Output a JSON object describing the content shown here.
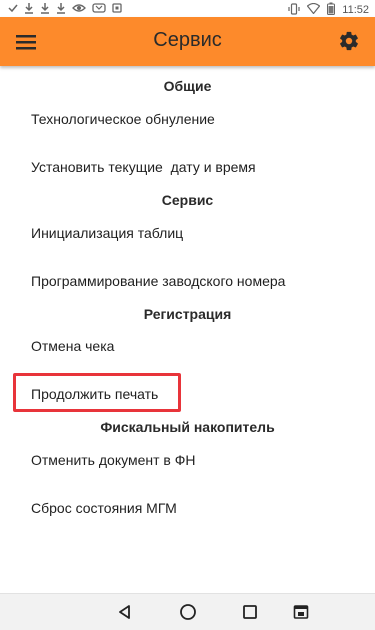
{
  "status_bar": {
    "time": "11:52",
    "left_icons": [
      "check-icon",
      "download-icon",
      "download-icon",
      "download-icon",
      "eye-icon",
      "vpn-icon",
      "square-icon"
    ],
    "right_icons": [
      "vibrate-icon",
      "wifi-icon",
      "battery-icon"
    ]
  },
  "app_bar": {
    "title": "Сервис",
    "menu_icon": "hamburger-menu-icon",
    "settings_icon": "gear-icon",
    "color": "#fd8a2b"
  },
  "sections": [
    {
      "title": "Общие",
      "items": [
        "Технологическое обнуление",
        "Установить текущие  дату и время"
      ]
    },
    {
      "title": "Сервис",
      "items": [
        "Инициализация таблиц",
        "Программирование заводского номера"
      ]
    },
    {
      "title": "Регистрация",
      "items": [
        "Отмена чека",
        "Продолжить печать"
      ]
    },
    {
      "title": "Фискальный накопитель",
      "items": [
        "Отменить документ в ФН",
        "Сброс состояния МГМ"
      ]
    }
  ],
  "highlight": {
    "color": "#e8343a",
    "target": "Продолжить печать"
  },
  "nav_bar": {
    "icons": [
      "back-icon",
      "home-icon",
      "recents-icon",
      "screenshot-icon"
    ]
  }
}
